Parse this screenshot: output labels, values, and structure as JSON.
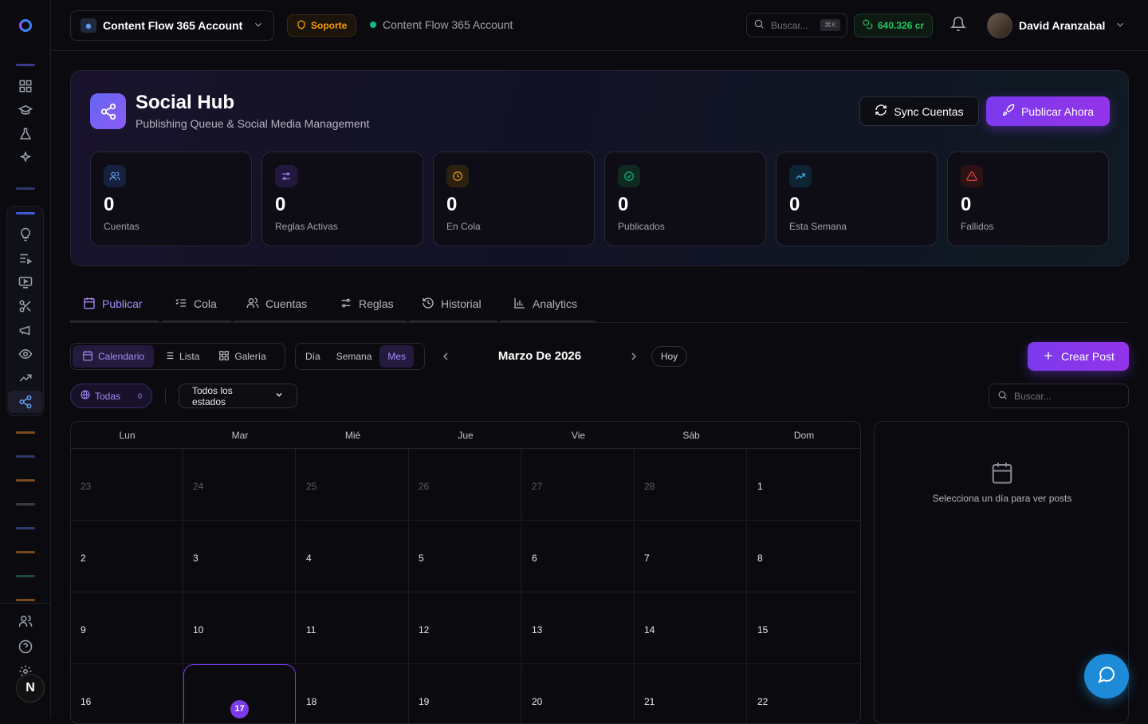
{
  "topbar": {
    "account_name": "Content Flow 365 Account",
    "support_label": "Soporte",
    "account_status": "Content Flow 365 Account",
    "search_placeholder": "Buscar...",
    "search_shortcut": "⌘K",
    "credits": "640.326 cr",
    "user_name": "David Aranzabal"
  },
  "hero": {
    "title": "Social Hub",
    "subtitle": "Publishing Queue & Social Media Management",
    "sync_label": "Sync Cuentas",
    "publish_label": "Publicar Ahora",
    "stats": [
      {
        "value": "0",
        "label": "Cuentas",
        "color": "#60a5fa",
        "icon": "users-icon"
      },
      {
        "value": "0",
        "label": "Reglas Activas",
        "color": "#a78bfa",
        "icon": "sliders-icon"
      },
      {
        "value": "0",
        "label": "En Cola",
        "color": "#f59e0b",
        "icon": "clock-icon"
      },
      {
        "value": "0",
        "label": "Publicados",
        "color": "#10b981",
        "icon": "check-circle-icon"
      },
      {
        "value": "0",
        "label": "Esta Semana",
        "color": "#38bdf8",
        "icon": "trending-up-icon"
      },
      {
        "value": "0",
        "label": "Fallidos",
        "color": "#ef4444",
        "icon": "alert-triangle-icon"
      }
    ]
  },
  "tabs": [
    {
      "label": "Publicar",
      "icon": "calendar-icon"
    },
    {
      "label": "Cola",
      "icon": "list-check-icon"
    },
    {
      "label": "Cuentas",
      "icon": "users-icon"
    },
    {
      "label": "Reglas",
      "icon": "sliders-icon"
    },
    {
      "label": "Historial",
      "icon": "history-icon"
    },
    {
      "label": "Analytics",
      "icon": "bar-chart-icon"
    }
  ],
  "toolbar": {
    "views": [
      "Calendario",
      "Lista",
      "Galería"
    ],
    "ranges": [
      "Día",
      "Semana",
      "Mes"
    ],
    "month_label": "Marzo De 2026",
    "today_label": "Hoy",
    "create_label": "Crear Post",
    "filter_all": "Todas",
    "filter_count": "0",
    "status_select": "Todos los estados",
    "search_placeholder": "Buscar..."
  },
  "calendar": {
    "weekdays": [
      "Lun",
      "Mar",
      "Mié",
      "Jue",
      "Vie",
      "Sáb",
      "Dom"
    ],
    "weeks": [
      [
        "23",
        "24",
        "25",
        "26",
        "27",
        "28",
        "1"
      ],
      [
        "2",
        "3",
        "4",
        "5",
        "6",
        "7",
        "8"
      ],
      [
        "9",
        "10",
        "11",
        "12",
        "13",
        "14",
        "15"
      ],
      [
        "16",
        "17",
        "18",
        "19",
        "20",
        "21",
        "22"
      ]
    ],
    "today": "17"
  },
  "side_panel": {
    "empty_text": "Selecciona un día para ver posts"
  },
  "colors": {
    "accent": "#7c3aed",
    "accent_light": "#a78bfa",
    "success": "#10b981",
    "warning": "#f59e0b",
    "chat": "#1d8bd8"
  }
}
